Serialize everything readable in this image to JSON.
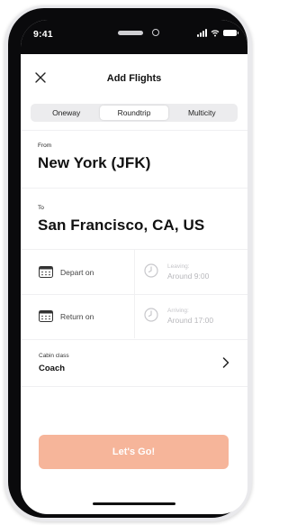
{
  "status_bar": {
    "time": "9:41"
  },
  "header": {
    "title": "Add Flights",
    "close_icon": "close-icon"
  },
  "trip_types": [
    {
      "label": "Oneway",
      "active": false
    },
    {
      "label": "Roundtrip",
      "active": true
    },
    {
      "label": "Multicity",
      "active": false
    }
  ],
  "from": {
    "label": "From",
    "value": "New York (JFK)"
  },
  "to": {
    "label": "To",
    "value": "San Francisco, CA, US"
  },
  "depart": {
    "label": "Depart on",
    "time_label": "Leaving:",
    "time_value": "Around 9:00",
    "date_icon": "calendar-icon",
    "time_icon": "clock-icon"
  },
  "return": {
    "label": "Return on",
    "time_label": "Arriving:",
    "time_value": "Around 17:00",
    "date_icon": "calendar-icon",
    "time_icon": "clock-icon"
  },
  "cabin": {
    "label": "Cabin class",
    "value": "Coach",
    "chevron_icon": "chevron-right-icon"
  },
  "cta": {
    "label": "Let's Go!",
    "color": "#f6b59a"
  },
  "colors": {
    "accent": "#f6b59a",
    "muted_text": "#b8b8bc",
    "divider": "#f0f0f2"
  }
}
